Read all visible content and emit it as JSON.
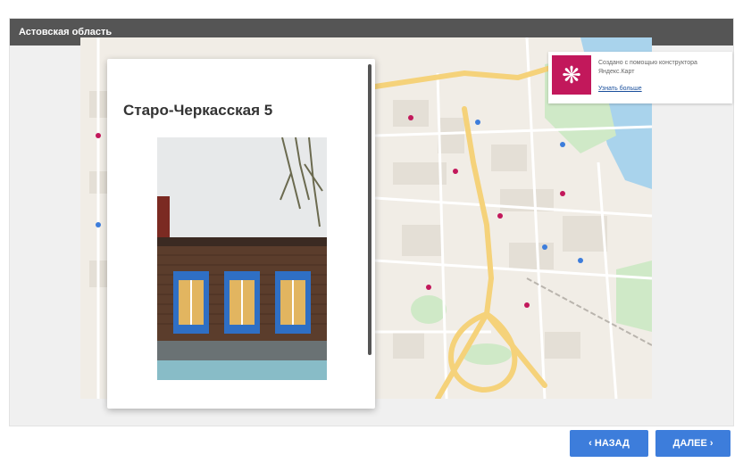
{
  "header": {
    "title": "Астовская область"
  },
  "popup": {
    "title": "Старо-Черкасская 5"
  },
  "attribution": {
    "text": "Создано с помощью конструктора Яндекс.Карт",
    "link": "Узнать больше"
  },
  "nav": {
    "back_label": "‹ НАЗАД",
    "next_label": "ДАЛЕЕ ›"
  },
  "colors": {
    "header_bg": "#555555",
    "button": "#3d7ddb",
    "logo": "#c2185b",
    "road": "#f5d27a",
    "water": "#a9d3ec",
    "park": "#cfe9c7"
  }
}
